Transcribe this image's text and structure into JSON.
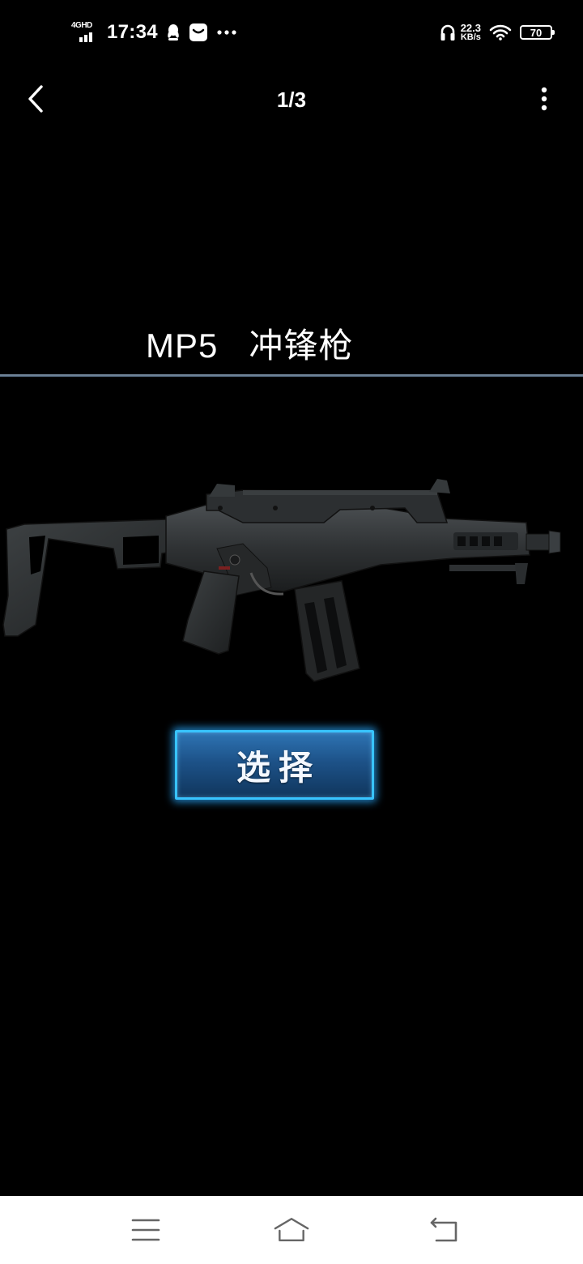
{
  "status_bar": {
    "network_label": "4GHD",
    "time": "17:34",
    "speed_value": "22.3",
    "speed_unit": "KB/s",
    "battery": "70",
    "icons": [
      "signal-icon",
      "qq-icon",
      "message-icon",
      "more-notifications-icon",
      "headphones-icon",
      "wifi-icon",
      "battery-icon"
    ]
  },
  "app_bar": {
    "page_counter": "1/3",
    "icons": [
      "back-arrow-icon",
      "more-vertical-icon"
    ]
  },
  "content": {
    "weapon_title": "MP5   冲锋枪",
    "weapon_image": "weapon-rifle-image",
    "select_label": "选择"
  },
  "nav_bar": {
    "icons": [
      "menu-icon",
      "home-icon",
      "back-icon"
    ]
  },
  "colors": {
    "background": "#000000",
    "button_border": "#38c4ff",
    "button_fill": "#1d5288",
    "divider": "#7b90a6"
  }
}
